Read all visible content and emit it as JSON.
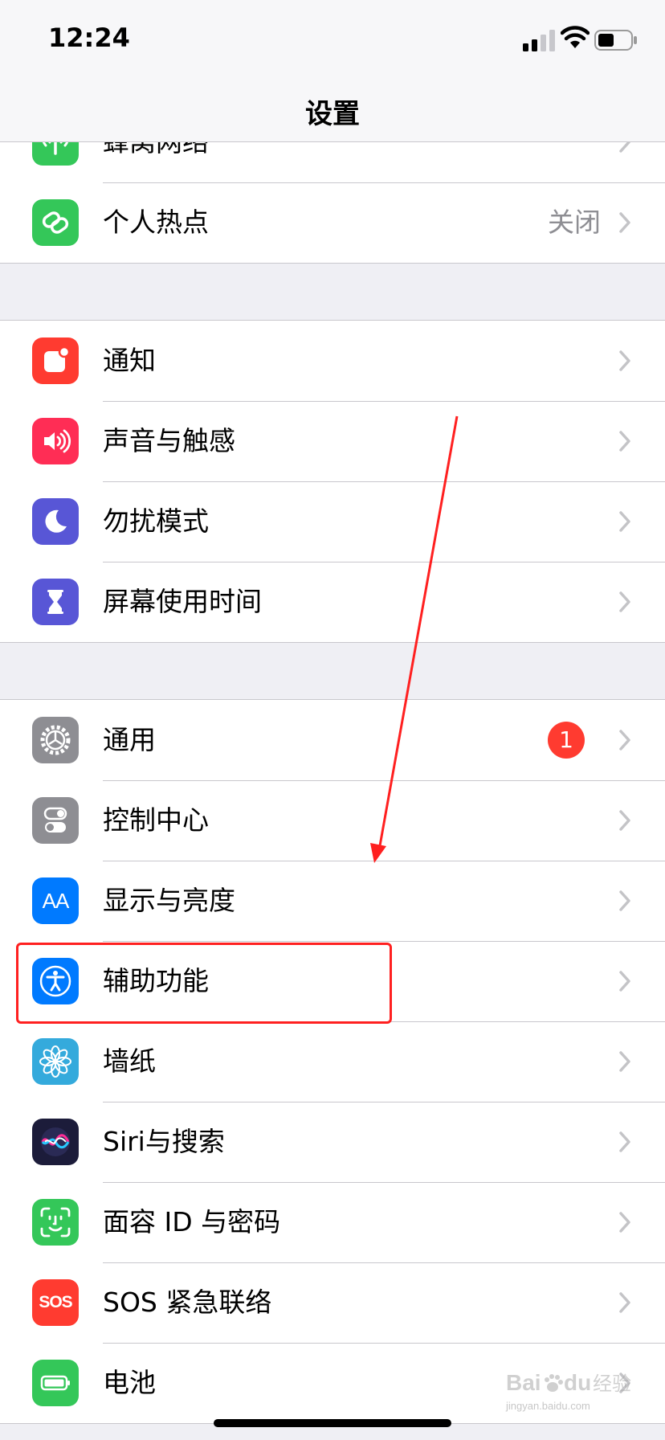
{
  "status_bar": {
    "time": "12:24"
  },
  "nav": {
    "title": "设置"
  },
  "groups": [
    {
      "rows": [
        {
          "label": "蜂窝网络",
          "icon": "cellular-antenna-icon",
          "color": "#34c759"
        },
        {
          "label": "个人热点",
          "value": "关闭",
          "icon": "hotspot-link-icon",
          "color": "#34c759"
        }
      ]
    },
    {
      "rows": [
        {
          "label": "通知",
          "icon": "notification-icon",
          "color": "#ff3b30"
        },
        {
          "label": "声音与触感",
          "icon": "speaker-icon",
          "color": "#ff2d55"
        },
        {
          "label": "勿扰模式",
          "icon": "moon-icon",
          "color": "#5856d6"
        },
        {
          "label": "屏幕使用时间",
          "icon": "hourglass-icon",
          "color": "#5856d6"
        }
      ]
    },
    {
      "rows": [
        {
          "label": "通用",
          "badge": "1",
          "icon": "gear-icon",
          "color": "#8e8e93"
        },
        {
          "label": "控制中心",
          "icon": "toggles-icon",
          "color": "#8e8e93"
        },
        {
          "label": "显示与亮度",
          "icon_text": "AA",
          "icon": "text-size-icon",
          "color": "#007aff"
        },
        {
          "label": "辅助功能",
          "icon": "accessibility-icon",
          "color": "#007aff"
        },
        {
          "label": "墙纸",
          "icon": "flower-icon",
          "color": "#34aadc"
        },
        {
          "label": "Siri与搜索",
          "icon": "siri-icon",
          "color": "#1c1c3a"
        },
        {
          "label": "面容 ID 与密码",
          "icon": "face-id-icon",
          "color": "#34c759"
        },
        {
          "label": "SOS 紧急联络",
          "icon_text": "SOS",
          "icon": "sos-icon",
          "color": "#ff3b30"
        },
        {
          "label": "电池",
          "icon": "battery-icon",
          "color": "#34c759"
        }
      ]
    }
  ],
  "annotation": {
    "highlight_color": "#ff2020"
  },
  "watermark": {
    "logo": "Baidu经验",
    "url": "jingyan.baidu.com"
  }
}
